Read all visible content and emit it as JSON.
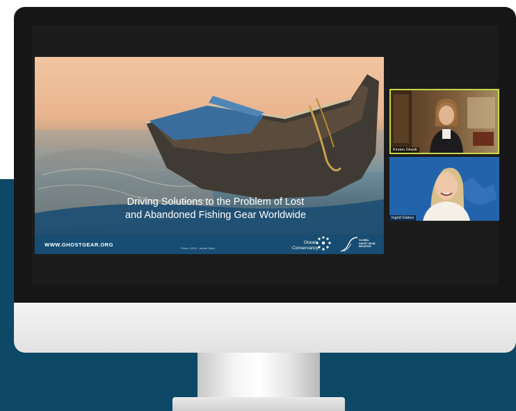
{
  "slide": {
    "title_line_1": "Driving Solutions to the Problem of Lost",
    "title_line_2": "and Abandoned Fishing Gear Worldwide",
    "url": "WWW.GHOSTGEAR.ORG",
    "photo_credit": "Photo: GGGI - Adobe Stock",
    "ocean_conservancy_line_1": "Ocean",
    "ocean_conservancy_line_2": "Conservancy",
    "ggi_line_1": "GLOBAL",
    "ggi_line_2": "GHOST GEAR",
    "ggi_line_3": "INITIATIVE"
  },
  "participants": [
    {
      "name": "Kirsten Gilardi"
    },
    {
      "name": "Ingrid Giskes"
    }
  ],
  "colors": {
    "background_band": "#0d4866",
    "active_speaker_border": "#c9d84a",
    "slide_footer": "#174d72"
  },
  "icons": [
    "ocean-conservancy-logo-icon",
    "ghost-gear-initiative-logo-icon"
  ]
}
